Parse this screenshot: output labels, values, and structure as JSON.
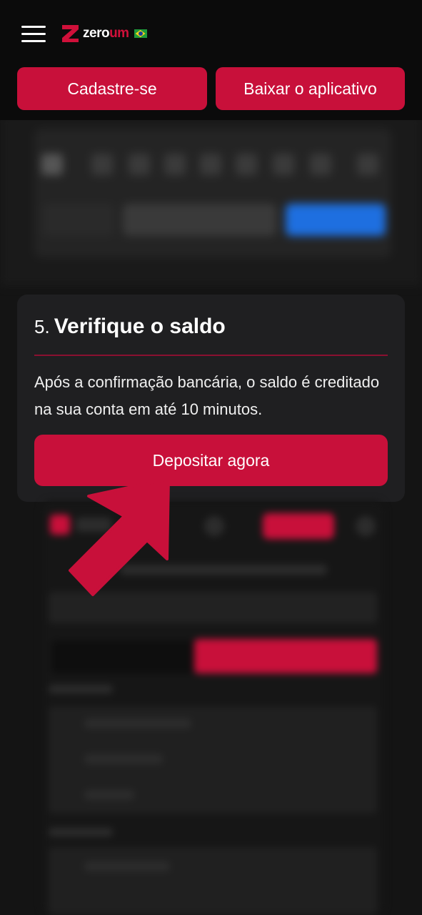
{
  "header": {
    "brand_zero": "zero",
    "brand_um": "um",
    "signup_label": "Cadastre-se",
    "download_label": "Baixar o aplicativo"
  },
  "step": {
    "number": "5.",
    "title": "Verifique o saldo",
    "description": "Após a confirmação bancária, o saldo é creditado na sua conta em até 10 minutos.",
    "deposit_label": "Depositar agora"
  },
  "colors": {
    "accent": "#c8103a",
    "background": "#141414",
    "card": "#1f1f21"
  },
  "icons": {
    "menu": "hamburger-menu-icon",
    "logo": "zeroum-logo",
    "flag": "brazil-flag-icon",
    "arrow": "pointer-arrow-icon"
  }
}
